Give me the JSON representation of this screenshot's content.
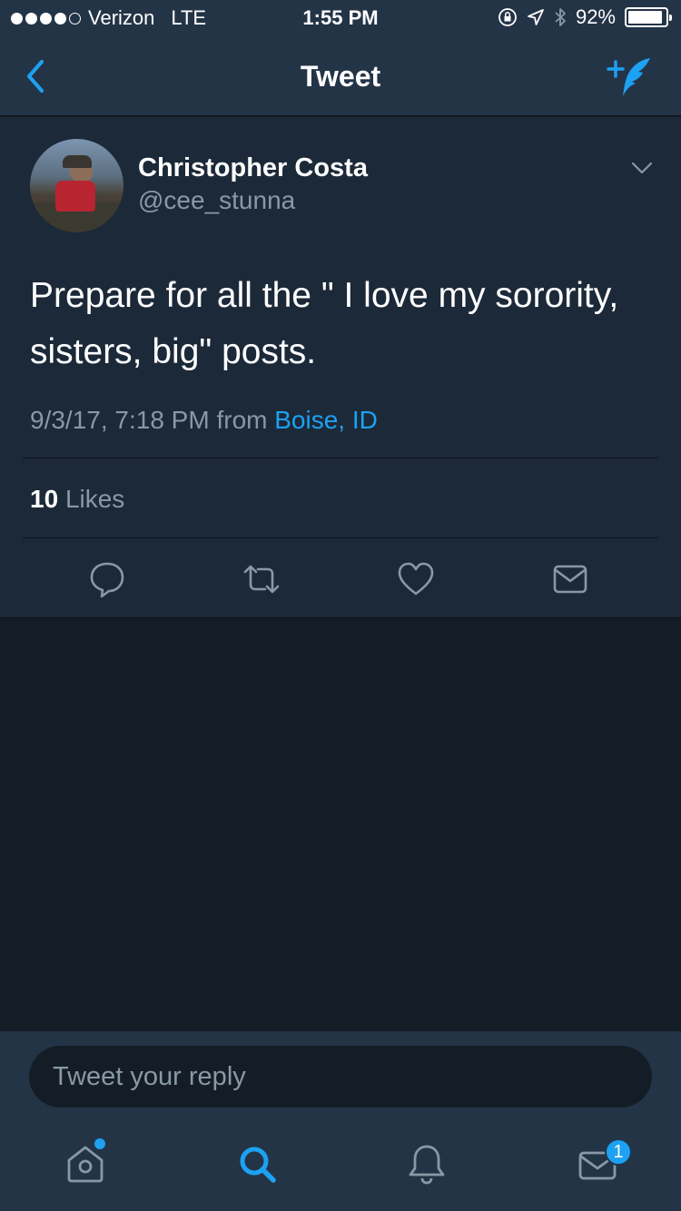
{
  "status_bar": {
    "carrier": "Verizon",
    "network": "LTE",
    "time": "1:55 PM",
    "battery_percent": "92%",
    "battery_level": 0.92
  },
  "nav": {
    "title": "Tweet",
    "back_icon": "chevron-left-icon",
    "compose_icon": "compose-tweet-icon"
  },
  "tweet": {
    "author_name": "Christopher Costa",
    "author_handle": "@cee_stunna",
    "text": "Prepare for all the \" I love my sorority, sisters, big\" posts.",
    "timestamp": "9/3/17, 7:18 PM from",
    "location": "Boise, ID",
    "likes_count": "10",
    "likes_label": "Likes"
  },
  "reply": {
    "placeholder": "Tweet your reply"
  },
  "tabs": {
    "messages_badge": "1"
  },
  "colors": {
    "accent": "#1da1f2",
    "background": "#141d26",
    "card": "#1c2938",
    "bars": "#243447",
    "secondary_text": "#8899a6"
  }
}
